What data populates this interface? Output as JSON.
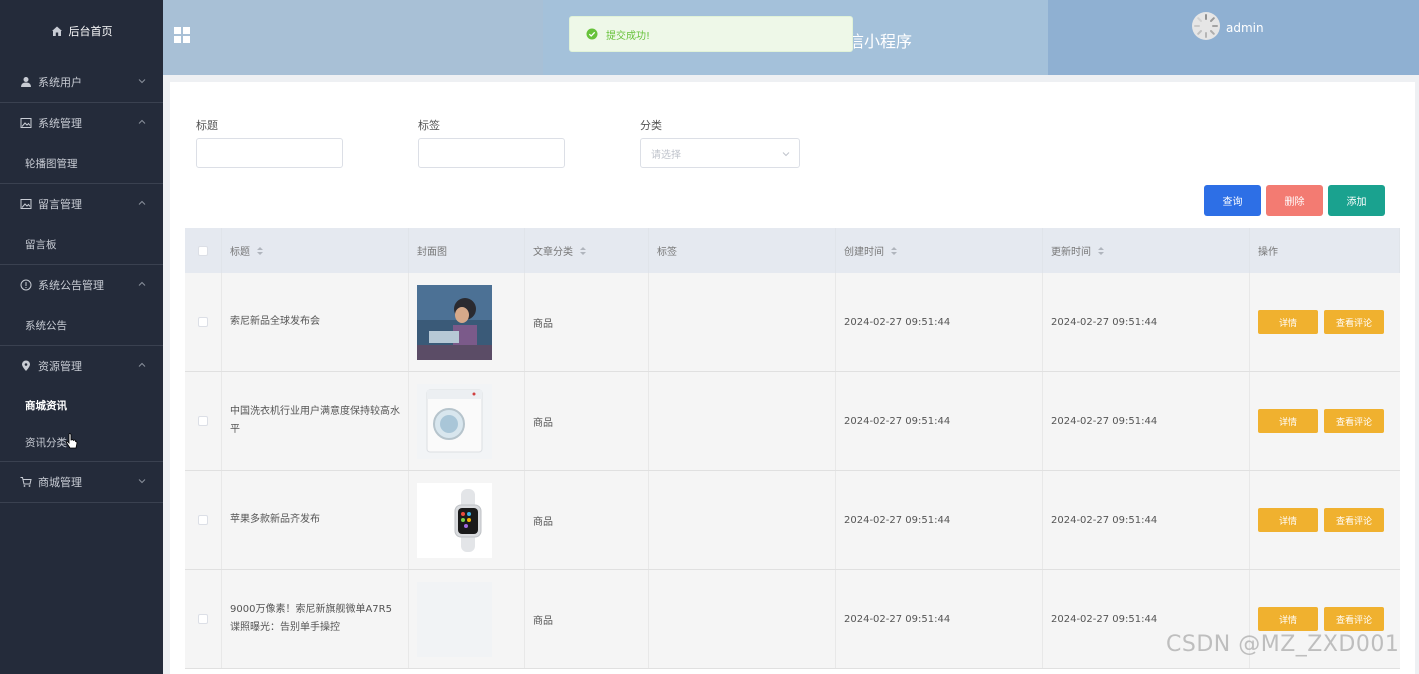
{
  "sidebar": {
    "home": "后台首页",
    "groups": [
      {
        "title": "系统用户",
        "icon": "user-icon",
        "children": []
      },
      {
        "title": "系统管理",
        "icon": "image-icon",
        "children": [
          "轮播图管理"
        ]
      },
      {
        "title": "留言管理",
        "icon": "image-icon",
        "children": [
          "留言板"
        ]
      },
      {
        "title": "系统公告管理",
        "icon": "info-icon",
        "children": [
          "系统公告"
        ]
      },
      {
        "title": "资源管理",
        "icon": "location-icon",
        "children": [
          "商城资讯",
          "资讯分类"
        ]
      },
      {
        "title": "商城管理",
        "icon": "cart-icon",
        "children": []
      }
    ],
    "active_item": "商城资讯"
  },
  "header": {
    "app_title": "信小程序",
    "username": "admin"
  },
  "toast": {
    "message": "提交成功!",
    "color": "#67c23a"
  },
  "filters": {
    "title_label": "标题",
    "tag_label": "标签",
    "category_label": "分类",
    "category_placeholder": "请选择"
  },
  "actions": {
    "query": "查询",
    "delete": "删除",
    "add": "添加",
    "query_color": "#2d6fe6",
    "delete_color": "#f37b72",
    "add_color": "#1aa28f"
  },
  "table": {
    "columns": [
      "标题",
      "封面图",
      "文章分类",
      "标签",
      "创建时间",
      "更新时间",
      "操作"
    ],
    "rows": [
      {
        "title": "索尼新品全球发布会",
        "thumb": "child-photo",
        "category": "商品",
        "tag": "",
        "created": "2024-02-27 09:51:44",
        "updated": "2024-02-27 09:51:44"
      },
      {
        "title": "中国洗衣机行业用户满意度保持较高水平",
        "thumb": "washer-photo",
        "category": "商品",
        "tag": "",
        "created": "2024-02-27 09:51:44",
        "updated": "2024-02-27 09:51:44"
      },
      {
        "title": "苹果多款新品齐发布",
        "thumb": "watch-photo",
        "category": "商品",
        "tag": "",
        "created": "2024-02-27 09:51:44",
        "updated": "2024-02-27 09:51:44"
      },
      {
        "title": "9000万像素！索尼新旗舰微单A7R5谍照曝光：告别单手操控",
        "thumb": "",
        "category": "商品",
        "tag": "",
        "created": "2024-02-27 09:51:44",
        "updated": "2024-02-27 09:51:44"
      }
    ],
    "detail_label": "详情",
    "comments_label": "查看评论"
  },
  "watermark": "CSDN @MZ_ZXD001"
}
